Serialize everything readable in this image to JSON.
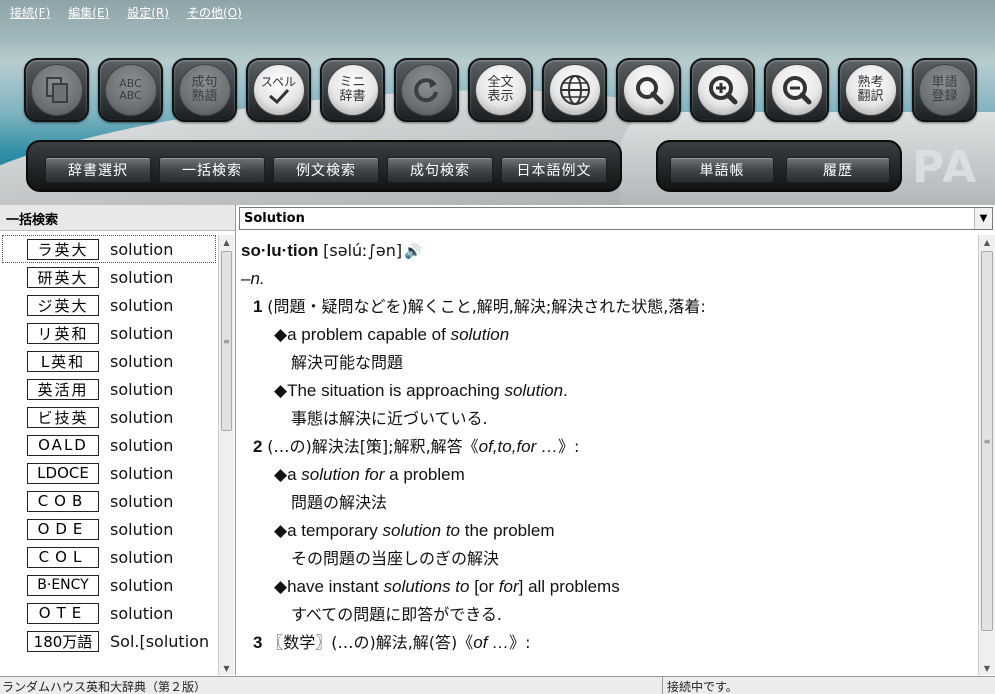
{
  "menu": [
    "接続(F)",
    "編集(E)",
    "設定(R)",
    "その他(O)"
  ],
  "toolbar": {
    "icons": [
      {
        "name": "copy-icon",
        "label": ""
      },
      {
        "name": "abc-compare-icon",
        "label": "ABC\nABC"
      },
      {
        "name": "phrase-icon",
        "label": "成句\n熟語"
      },
      {
        "name": "spell-check-icon",
        "label": "スペル"
      },
      {
        "name": "mini-dictionary-icon",
        "label": "ミニ\n辞書"
      },
      {
        "name": "refresh-icon",
        "label": ""
      },
      {
        "name": "full-text-icon",
        "label": "全文\n表示"
      },
      {
        "name": "globe-icon",
        "label": ""
      },
      {
        "name": "search-icon",
        "label": ""
      },
      {
        "name": "zoom-in-icon",
        "label": ""
      },
      {
        "name": "zoom-out-icon",
        "label": ""
      },
      {
        "name": "idiom-translation-icon",
        "label": "熟考\n翻訳"
      },
      {
        "name": "word-register-icon",
        "label": "単語\n登録"
      }
    ]
  },
  "tabs": {
    "left": [
      "辞書選択",
      "一括検索",
      "例文検索",
      "成句検索",
      "日本語例文"
    ],
    "right": [
      "単語帳",
      "履歴"
    ]
  },
  "brand": "PA",
  "left_pane": {
    "title": "一括検索",
    "results": [
      {
        "dict": "ラ英大",
        "word": "solution"
      },
      {
        "dict": "研英大",
        "word": "solution"
      },
      {
        "dict": "ジ英大",
        "word": "solution"
      },
      {
        "dict": "リ英和",
        "word": "solution"
      },
      {
        "dict": "L英和",
        "word": "solution"
      },
      {
        "dict": "英活用",
        "word": "solution"
      },
      {
        "dict": "ビ技英",
        "word": "solution"
      },
      {
        "dict": "OALD",
        "word": "solution"
      },
      {
        "dict": "LDOCE",
        "word": "solution"
      },
      {
        "dict": "COB",
        "word": "solution"
      },
      {
        "dict": "ODE",
        "word": "solution"
      },
      {
        "dict": "COL",
        "word": "solution"
      },
      {
        "dict": "B·ENCY",
        "word": "solution"
      },
      {
        "dict": "OTE",
        "word": "solution"
      },
      {
        "dict": "180万語",
        "word": "Sol.[solution"
      }
    ]
  },
  "search": {
    "value": "Solution"
  },
  "entry": {
    "headword": "so·lu·tion",
    "pronunciation": "[səlúː∫ən]",
    "pos": "–n.",
    "s1_num": "1",
    "s1_def": "(問題・疑問などを)解くこと,解明,解決;解決された状態,落着:",
    "s1_ex1_pre": "◆a problem capable of ",
    "s1_ex1_em": "solution",
    "s1_ex1_ja": "解決可能な問題",
    "s1_ex2_pre": "◆The situation is approaching ",
    "s1_ex2_em": "solution",
    "s1_ex2_post": ".",
    "s1_ex2_ja": "事態は解決に近づいている.",
    "s2_num": "2",
    "s2_def_pre": "(…の)解決法[策];解釈,解答《",
    "s2_def_em": "of,to,for …",
    "s2_def_post": "》:",
    "s2_ex1_pre": "◆a ",
    "s2_ex1_em": "solution for",
    "s2_ex1_post": " a problem",
    "s2_ex1_ja": "問題の解決法",
    "s2_ex2_pre": "◆a temporary ",
    "s2_ex2_em": "solution to",
    "s2_ex2_post": " the problem",
    "s2_ex2_ja": "その問題の当座しのぎの解決",
    "s2_ex3_pre": "◆have instant ",
    "s2_ex3_em1": "solutions to",
    "s2_ex3_mid": " [or ",
    "s2_ex3_em2": "for",
    "s2_ex3_post": "] all problems",
    "s2_ex3_ja": "すべての問題に即答ができる.",
    "s3_num": "3",
    "s3_def_pre": "〖数学〗(…の)解法,解(答)《",
    "s3_def_em": "of …",
    "s3_def_post": "》:"
  },
  "status": {
    "left": "ランダムハウス英和大辞典（第２版）",
    "right": "接続中です。"
  }
}
